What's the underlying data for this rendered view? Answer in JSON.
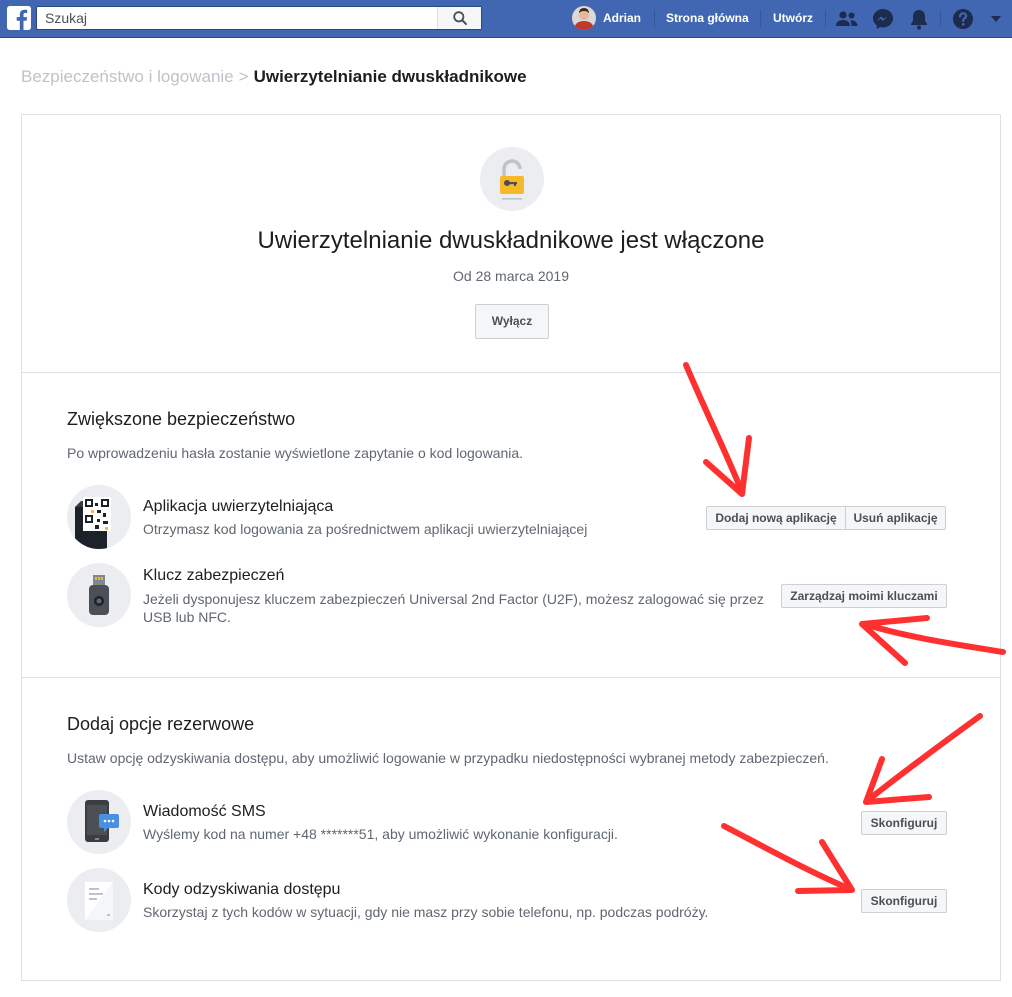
{
  "header": {
    "search_placeholder": "Szukaj",
    "user_name": "Adrian",
    "home_label": "Strona główna",
    "create_label": "Utwórz",
    "icons": [
      "facebook-logo",
      "search-icon",
      "friends-icon",
      "messenger-icon",
      "notifications-icon",
      "help-icon",
      "dropdown-arrow-icon"
    ],
    "brand_color": "#4267b2"
  },
  "breadcrumb": {
    "parent": "Bezpieczeństwo i logowanie",
    "separator": ">",
    "current": "Uwierzytelnianie dwuskładnikowe"
  },
  "hero": {
    "title": "Uwierzytelnianie dwuskładnikowe jest włączone",
    "date": "Od 28 marca 2019",
    "button_label": "Wyłącz"
  },
  "security": {
    "title": "Zwiększone bezpieczeństwo",
    "description": "Po wprowadzeniu hasła zostanie wyświetlone zapytanie o kod logowania.",
    "options": [
      {
        "title": "Aplikacja uwierzytelniająca",
        "description": "Otrzymasz kod logowania za pośrednictwem aplikacji uwierzytelniającej",
        "buttons": [
          "Dodaj nową aplikację",
          "Usuń aplikację"
        ]
      },
      {
        "title": "Klucz zabezpieczeń",
        "description": "Jeżeli dysponujesz kluczem zabezpieczeń Universal 2nd Factor (U2F), możesz zalogować się przez USB lub NFC.",
        "buttons": [
          "Zarządzaj moimi kluczami"
        ]
      }
    ]
  },
  "backup": {
    "title": "Dodaj opcje rezerwowe",
    "description": "Ustaw opcję odzyskiwania dostępu, aby umożliwić logowanie w przypadku niedostępności wybranej metody zabezpieczeń.",
    "options": [
      {
        "title": "Wiadomość SMS",
        "description": "Wyślemy kod na numer +48 *******51, aby umożliwić wykonanie konfiguracji.",
        "buttons": [
          "Skonfiguruj"
        ]
      },
      {
        "title": "Kody odzyskiwania dostępu",
        "description": "Skorzystaj z tych kodów w sytuacji, gdy nie masz przy sobie telefonu, np. podczas podróży.",
        "buttons": [
          "Skonfiguruj"
        ]
      }
    ]
  },
  "annotation_color": "#ff1a1a"
}
